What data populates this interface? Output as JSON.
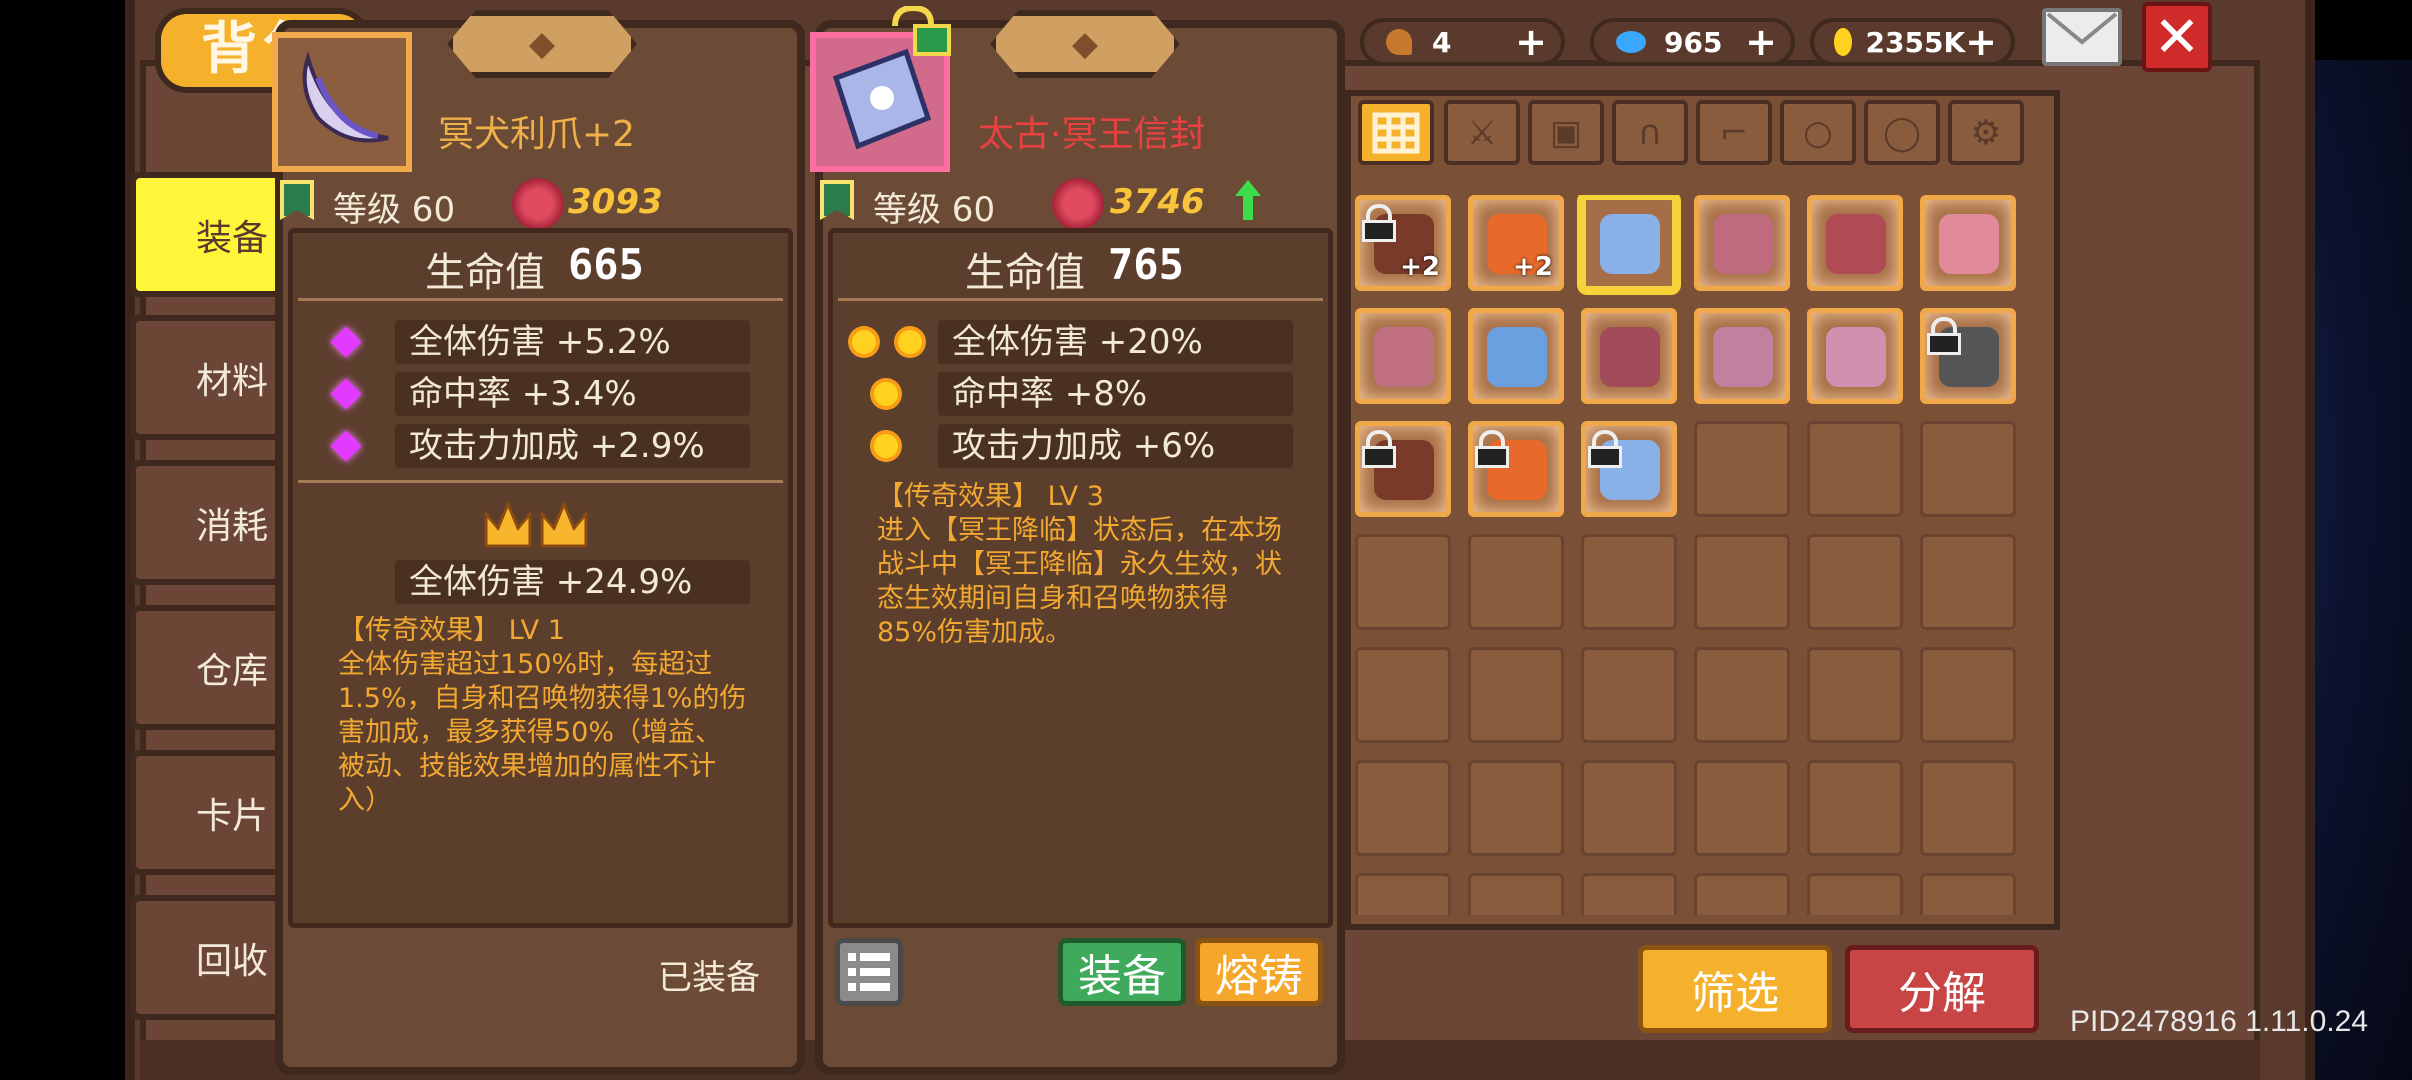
{
  "header": {
    "title": "背包",
    "currencies": [
      {
        "name": "keys",
        "value": "4",
        "color": "#c8792e"
      },
      {
        "name": "gems",
        "value": "965",
        "color": "#3aa8ff"
      },
      {
        "name": "gold",
        "value": "2355K",
        "color": "#ffd21f"
      }
    ]
  },
  "sidebar": {
    "items": [
      {
        "label": "装备",
        "active": true
      },
      {
        "label": "材料"
      },
      {
        "label": "消耗"
      },
      {
        "label": "仓库"
      },
      {
        "label": "卡片"
      },
      {
        "label": "回收"
      }
    ]
  },
  "equipped_card": {
    "name": "冥犬利爪+2",
    "name_color": "#f0b14a",
    "level": "等级 60",
    "power": "3093",
    "hp_label": "生命值",
    "hp_value": "665",
    "stats": [
      "全体伤害 +5.2%",
      "命中率 +3.4%",
      "攻击力加成 +2.9%"
    ],
    "bonus_stat": "全体伤害 +24.9%",
    "legend_title": "【传奇效果】 LV 1",
    "legend_text": "全体伤害超过150%时，每超过1.5%，自身和召唤物获得1%的伤害加成，最多获得50%（增益、被动、技能效果增加的属性不计入）",
    "status": "已装备"
  },
  "new_card": {
    "name": "太古·冥王信封",
    "name_color": "#e84141",
    "level": "等级 60",
    "power": "3746",
    "hp_label": "生命值",
    "hp_value": "765",
    "stats": [
      "全体伤害 +20%",
      "命中率 +8%",
      "攻击力加成 +6%"
    ],
    "legend_title": "【传奇效果】 LV 3",
    "legend_text": "进入【冥王降临】状态后，在本场战斗中【冥王降临】永久生效，状态生效期间自身和召唤物获得85%伤害加成。",
    "equip_button": "装备",
    "forge_button": "熔铸"
  },
  "inventory": {
    "category_tabs": [
      "all-icon",
      "sword-icon",
      "armor-icon",
      "helmet-icon",
      "boots-icon",
      "ring-icon",
      "necklace-icon",
      "gear-icon"
    ],
    "rows": [
      [
        {
          "locked": true,
          "plus": "+2"
        },
        {
          "plus": "+2"
        },
        {
          "selected": true
        },
        {},
        {},
        {}
      ],
      [
        {},
        {},
        {},
        {},
        {},
        {
          "locked": true
        }
      ],
      [
        {
          "locked": true
        },
        {
          "locked": true
        },
        {
          "locked": true
        }
      ]
    ],
    "filter_button": "筛选",
    "decompose_button": "分解"
  },
  "footer": {
    "version": "PID2478916 1.11.0.24"
  }
}
